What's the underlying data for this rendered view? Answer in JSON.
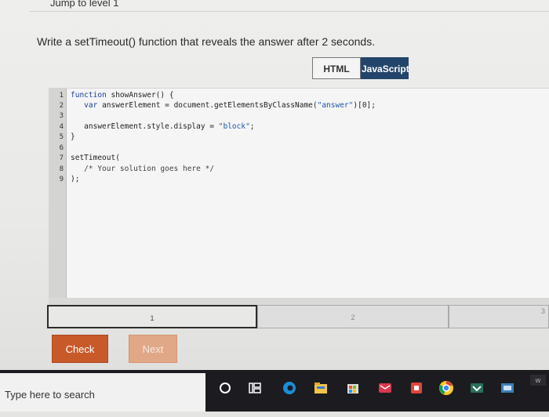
{
  "header": {
    "jump_label": "Jump to level 1"
  },
  "prompt": {
    "text": "Write a setTimeout() function that reveals the answer after 2 seconds."
  },
  "tabs": [
    {
      "label": "HTML",
      "active": false
    },
    {
      "label": "JavaScript",
      "active": true
    }
  ],
  "editor": {
    "line_numbers": [
      "1",
      "2",
      "3",
      "4",
      "5",
      "6",
      "7",
      "8",
      "9"
    ]
  },
  "progress": {
    "steps": [
      "1",
      "2",
      "3"
    ],
    "current": "1"
  },
  "buttons": {
    "check": "Check",
    "next": "Next"
  },
  "taskbar": {
    "search_placeholder": "Type here to search",
    "icons": [
      "cortana-circle-icon",
      "task-view-icon",
      "edge-icon",
      "file-explorer-icon",
      "store-icon",
      "mail-icon",
      "office-icon",
      "chrome-icon",
      "vpn-icon",
      "tray-app-icon"
    ]
  },
  "colors": {
    "accent_tab": "#23456b",
    "check_button": "#c85a2a",
    "next_button": "#e0a886",
    "taskbar": "#1c1c20"
  }
}
